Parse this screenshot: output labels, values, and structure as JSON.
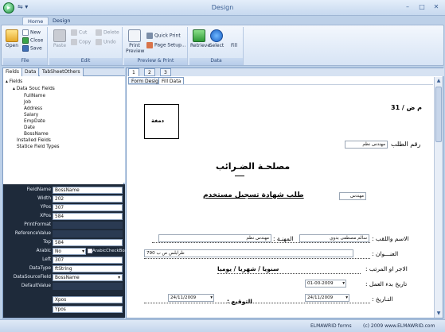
{
  "window": {
    "title": "Design",
    "qat": "⇋ ▾ ",
    "min": "–",
    "max": "□",
    "close": "✕"
  },
  "tabs": [
    "Home",
    "Design"
  ],
  "ribbon": {
    "file": {
      "label": "File",
      "open": "Open",
      "new": "New",
      "close": "Close",
      "save": "Save"
    },
    "edit": {
      "label": "Edit",
      "paste": "Paste",
      "cut": "Cut",
      "copy": "Copy",
      "delete": "Delete",
      "undo": "Undo"
    },
    "preview": {
      "label": "Preview & Print",
      "print_preview": "Print Preview",
      "quick_print": "Quick Print",
      "page_setup": "Page Setup..."
    },
    "data": {
      "label": "Data",
      "retrieve": "Retrieve",
      "select": "Select",
      "fill": "Fill"
    }
  },
  "left_tabs": [
    "Fields",
    "Data",
    "TabSheetOthers"
  ],
  "tree": {
    "root": "Fields",
    "source": "Data Souc Fields",
    "items": [
      "FullName",
      "Job",
      "Address",
      "Salary",
      "EmpDate",
      "Date",
      "BossName"
    ],
    "installed": "Installed Fields",
    "static": "Statice Field Types"
  },
  "props": [
    {
      "label": "FieldName",
      "value": "BossName"
    },
    {
      "label": "Width",
      "value": "202"
    },
    {
      "label": "YPos",
      "value": "307"
    },
    {
      "label": "XPos",
      "value": "584"
    },
    {
      "label": "PrintFormat",
      "value": ""
    },
    {
      "label": "ReferenceValue",
      "value": ""
    },
    {
      "label": "Top",
      "value": "584"
    },
    {
      "label": "Arabic",
      "value": "No"
    },
    {
      "label": "Left",
      "value": "307"
    },
    {
      "label": "DataType",
      "value": "ftString"
    },
    {
      "label": "DataSourceField",
      "value": "BossName"
    },
    {
      "label": "DefaultValue",
      "value": ""
    },
    {
      "label": "",
      "value": "Xpos"
    },
    {
      "label": "",
      "value": "Ypos"
    }
  ],
  "arabic_checkbox": "ArabicCheckBox",
  "canvas_tabs": [
    "1",
    "2",
    "3"
  ],
  "sub_tabs": [
    "Form Design",
    "Fill Data"
  ],
  "form": {
    "ref_no": "م ض / 31",
    "stamp": "دمغة",
    "req_label": "رقم الطلب",
    "req_value": "مهندس نظم",
    "small_value": "مهندس",
    "heading": "مصلحـة الضـرائب",
    "subheading": "طلب شهادة تسجيل مستخدم",
    "name_label": "الاسم واللقب :",
    "name_value": "سالم مصطفى بدوي",
    "job_label": "المهنـة :",
    "job_value": "مهندس نظم",
    "address_label": "العنـــوان :",
    "address_value": "طرابلس ص ب 790",
    "salary_label": "الاجر او المرتب :",
    "salary_unit": "سنويا / شهريا / يوميا",
    "start_label": "تاريخ بدء العمل :",
    "start_value": "01-00-2009",
    "date_label": "التـاريخ :",
    "date_value": "24/11/2009",
    "sign_label": "التوقيع :",
    "sign_date": "24/11/2009"
  },
  "status": {
    "left": "ELMAWRID forms",
    "right": "(c) 2009 www.ELMAWRID.com"
  }
}
